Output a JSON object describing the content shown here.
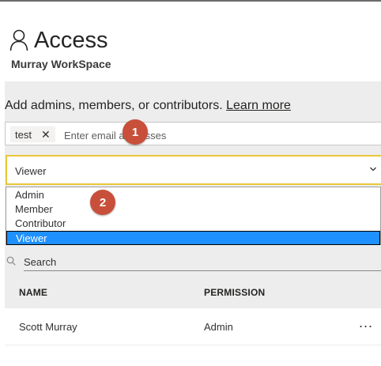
{
  "header": {
    "title": "Access",
    "workspace": "Murray WorkSpace"
  },
  "add_section": {
    "prompt": "Add admins, members, or contributors.",
    "learn_more": "Learn more"
  },
  "email_field": {
    "chip_label": "test",
    "placeholder": "Enter email addresses"
  },
  "role_select": {
    "value": "Viewer",
    "options": [
      "Admin",
      "Member",
      "Contributor",
      "Viewer"
    ],
    "selected_index": 3
  },
  "search": {
    "placeholder": "Search"
  },
  "table": {
    "headers": [
      "NAME",
      "PERMISSION"
    ],
    "rows": [
      {
        "name": "Scott Murray",
        "permission": "Admin",
        "more": "..."
      }
    ]
  },
  "callouts": [
    "1",
    "2"
  ],
  "colors": {
    "callout": "#c8503a",
    "selected_option": "#1e90ff",
    "focus_border": "#e8c73a",
    "panel": "#ededed"
  }
}
